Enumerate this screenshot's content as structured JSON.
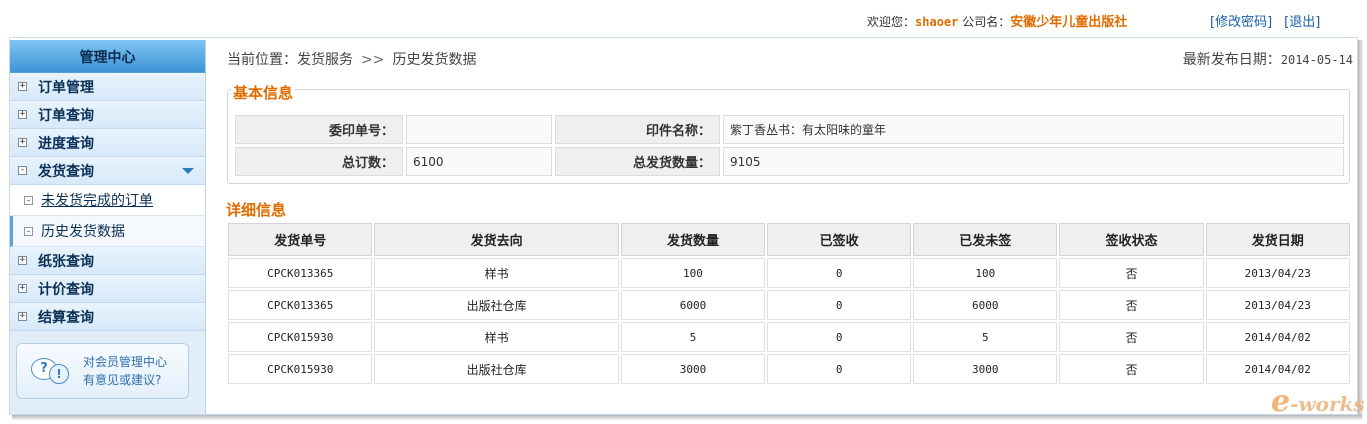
{
  "header": {
    "welcome_label": "欢迎您：",
    "username": "shaoer",
    "company_label": "公司名：",
    "company_name": "安徽少年儿童出版社",
    "change_password": "[修改密码]",
    "logout": "[退出]"
  },
  "sidebar": {
    "title": "管理中心",
    "items": [
      {
        "label": "订单管理",
        "toggle": "+"
      },
      {
        "label": "订单查询",
        "toggle": "+"
      },
      {
        "label": "进度查询",
        "toggle": "+"
      },
      {
        "label": "发货查询",
        "toggle": "-"
      },
      {
        "label": "纸张查询",
        "toggle": "+"
      },
      {
        "label": "计价查询",
        "toggle": "+"
      },
      {
        "label": "结算查询",
        "toggle": "+"
      }
    ],
    "subitems": [
      {
        "label": "未发货完成的订单"
      },
      {
        "label": "历史发货数据"
      }
    ],
    "help": {
      "line1": "对会员管理中心",
      "line2": "有意见或建议?",
      "icon_q": "?",
      "icon_e": "!"
    }
  },
  "breadcrumb": {
    "prefix": "当前位置：",
    "section": "发货服务",
    "separator": ">>",
    "page": "历史发货数据"
  },
  "publish": {
    "label": "最新发布日期：",
    "date": "2014-05-14"
  },
  "basic_info": {
    "title": "基本信息",
    "order_no_label": "委印单号：",
    "order_no_value": "",
    "print_name_label": "印件名称：",
    "print_name_value": "紫丁香丛书：有太阳味的童年",
    "total_order_label": "总订数：",
    "total_order_value": "6100",
    "total_shipped_label": "总发货数量：",
    "total_shipped_value": "9105"
  },
  "detail": {
    "title": "详细信息",
    "columns": [
      "发货单号",
      "发货去向",
      "发货数量",
      "已签收",
      "已发未签",
      "签收状态",
      "发货日期"
    ],
    "rows": [
      [
        "CPCK013365",
        "样书",
        "100",
        "0",
        "100",
        "否",
        "2013/04/23"
      ],
      [
        "CPCK013365",
        "出版社仓库",
        "6000",
        "0",
        "6000",
        "否",
        "2013/04/23"
      ],
      [
        "CPCK015930",
        "样书",
        "5",
        "0",
        "5",
        "否",
        "2014/04/02"
      ],
      [
        "CPCK015930",
        "出版社仓库",
        "3000",
        "0",
        "3000",
        "否",
        "2014/04/02"
      ]
    ]
  },
  "watermark": {
    "e": "e",
    "rest": "-works"
  }
}
